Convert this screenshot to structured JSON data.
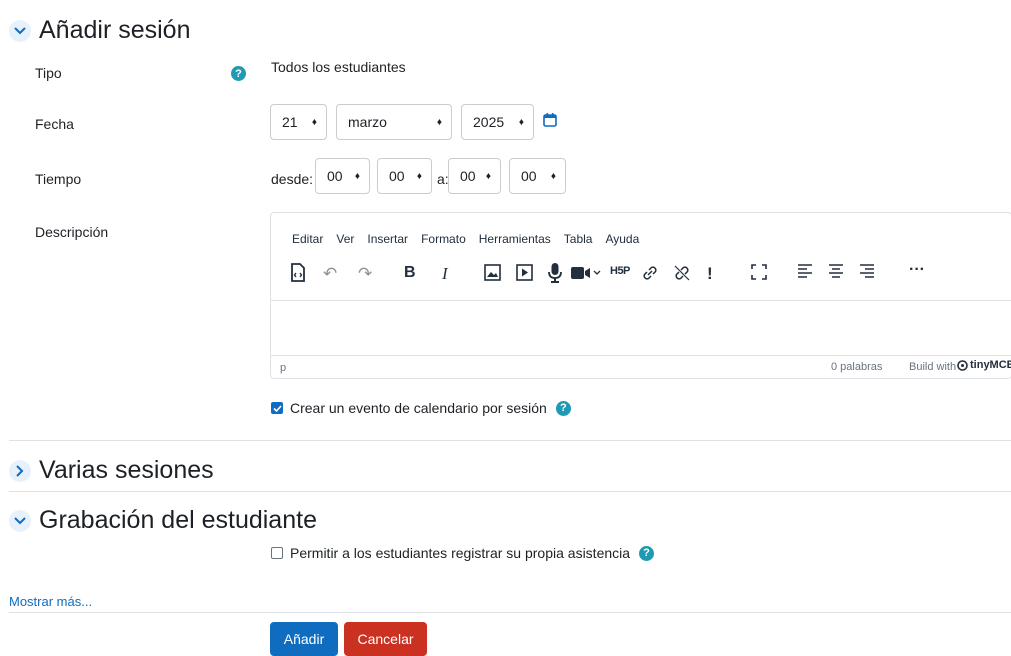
{
  "sections": {
    "add_session": "Añadir sesión",
    "multiple_sessions": "Varias sesiones",
    "student_recording": "Grabación del estudiante"
  },
  "form": {
    "type_label": "Tipo",
    "type_value": "Todos los estudiantes",
    "date_label": "Fecha",
    "date_day": "21",
    "date_month": "marzo",
    "date_year": "2025",
    "time_label": "Tiempo",
    "time_from": "desde:",
    "time_from_hour": "00",
    "time_from_min": "00",
    "time_to": "a:",
    "time_to_hour": "00",
    "time_to_min": "00",
    "description_label": "Descripción",
    "calendar_event_label": "Crear un evento de calendario por sesión",
    "self_register_label": "Permitir a los estudiantes registrar su propia asistencia",
    "show_more": "Mostrar más..."
  },
  "editor": {
    "menu": [
      "Editar",
      "Ver",
      "Insertar",
      "Formato",
      "Herramientas",
      "Tabla",
      "Ayuda"
    ],
    "status_path": "p",
    "word_count": "0 palabras",
    "build_with": "Build with",
    "brand": "tinyMCE",
    "toolbar": {
      "bold": "B",
      "italic": "I",
      "h5p": "H5P",
      "important": "!",
      "more": "···"
    }
  },
  "buttons": {
    "add": "Añadir",
    "cancel": "Cancelar"
  },
  "colors": {
    "primary": "#0f6cbf",
    "danger": "#ca3120",
    "help": "#1e9bb3",
    "link": "#0f6cbf"
  }
}
